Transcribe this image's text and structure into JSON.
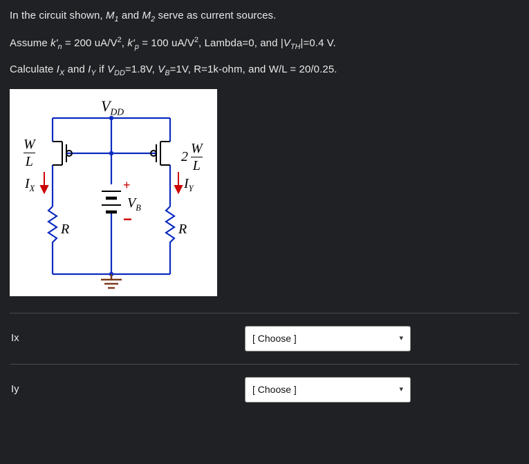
{
  "prompt": {
    "line1_a": "In the circuit shown, ",
    "m1": "M",
    "one": "1",
    "line1_b": " and ",
    "m2": "M",
    "two": "2",
    "line1_c": " serve as current sources.",
    "line2_a": "Assume ",
    "kn": "k'",
    "kn_sub": "n",
    "line2_b": " = 200 uA/V",
    "sq1": "2",
    "line2_c": ", ",
    "kp": "k'",
    "kp_sub": "p",
    "line2_d": " = 100 uA/V",
    "sq2": "2",
    "line2_e": ", Lambda=0, and |",
    "vth": "V",
    "vth_sub": "TH",
    "line2_f": "|=0.4 V.",
    "line3_a": "Calculate ",
    "ix": "I",
    "ix_sub": "X",
    "line3_b": " and ",
    "iy": "I",
    "iy_sub": "Y",
    "line3_c": " if ",
    "vdd": "V",
    "vdd_sub": "DD",
    "line3_d": "=1.8V, ",
    "vb": "V",
    "vb_sub": "B",
    "line3_e": "=1V, R=1k-ohm, and W/L = 20/0.25."
  },
  "circuit": {
    "vdd": "V",
    "vdd_sub": "DD",
    "W": "W",
    "L": "L",
    "two": "2",
    "Ix": "I",
    "Ix_sub": "X",
    "Iy": "I",
    "Iy_sub": "Y",
    "plus": "+",
    "minus": "−",
    "Vb": "V",
    "Vb_sub": "B",
    "R1": "R",
    "R2": "R"
  },
  "answers": {
    "ix_label": "Ix",
    "iy_label": "Iy",
    "choose": "[ Choose ]"
  }
}
